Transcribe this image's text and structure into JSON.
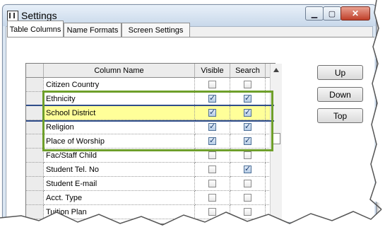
{
  "window": {
    "title": "Settings"
  },
  "title_buttons": {
    "minimize_icon": "minimize-icon",
    "maximize_icon": "maximize-icon",
    "close_icon": "close-icon"
  },
  "tabs": [
    {
      "label": "Table Columns",
      "active": true
    },
    {
      "label": "Name Formats",
      "active": false
    },
    {
      "label": "Screen Settings",
      "active": false
    }
  ],
  "grid": {
    "headers": {
      "name": "Column Name",
      "visible": "Visible",
      "search": "Search"
    },
    "rows": [
      {
        "name": "Citizen Country",
        "visible": false,
        "search": false
      },
      {
        "name": "Ethnicity",
        "visible": true,
        "search": true
      },
      {
        "name": "School District",
        "visible": true,
        "search": true,
        "selected": true
      },
      {
        "name": "Religion",
        "visible": true,
        "search": true
      },
      {
        "name": "Place of Worship",
        "visible": true,
        "search": true
      },
      {
        "name": "Fac/Staff Child",
        "visible": false,
        "search": false
      },
      {
        "name": "Student Tel. No",
        "visible": false,
        "search": true
      },
      {
        "name": "Student E-mail",
        "visible": false,
        "search": false
      },
      {
        "name": "Acct. Type",
        "visible": false,
        "search": false
      },
      {
        "name": "Tuition Plan",
        "visible": false,
        "search": false
      }
    ]
  },
  "buttons": {
    "up": "Up",
    "down": "Down",
    "top": "Top"
  },
  "colors": {
    "highlight_box": "#6e9f2a",
    "selected_row": "#ffff99",
    "selection_line": "#2f4d8a"
  }
}
